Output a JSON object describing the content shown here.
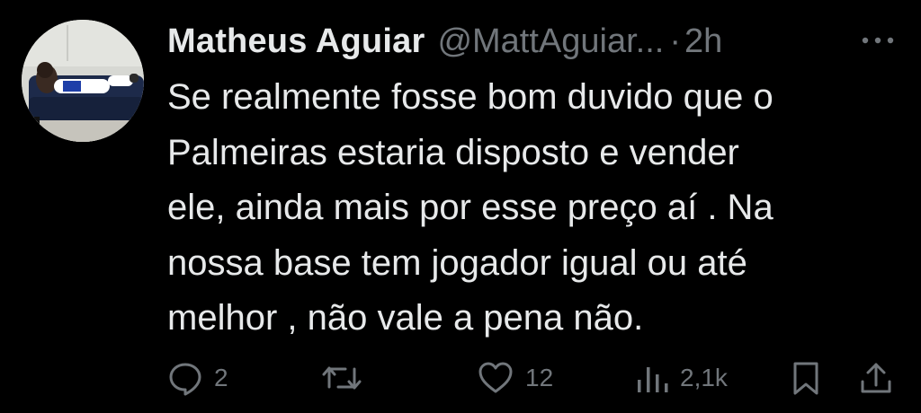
{
  "tweet": {
    "author": {
      "display_name": "Matheus Aguiar",
      "handle": "@MattAguiar...",
      "avatar_icon": "avatar-photo"
    },
    "separator": "·",
    "time": "2h",
    "more_icon": "more-dots-icon",
    "text_lines": [
      "Se realmente fosse bom duvido que o",
      "Palmeiras estaria disposto e vender",
      "ele, ainda mais por esse preço aí . Na",
      "nossa base tem jogador igual ou até",
      "melhor , não vale a pena não."
    ],
    "actions": {
      "reply": {
        "icon": "reply-icon",
        "count": "2"
      },
      "retweet": {
        "icon": "retweet-icon",
        "count": ""
      },
      "like": {
        "icon": "heart-icon",
        "count": "12"
      },
      "views": {
        "icon": "views-chart-icon",
        "count": "2,1k"
      },
      "bookmark": {
        "icon": "bookmark-icon"
      },
      "share": {
        "icon": "share-icon"
      }
    }
  },
  "colors": {
    "background": "#000000",
    "primary_text": "#e7e9ea",
    "secondary_text": "#71767b"
  }
}
